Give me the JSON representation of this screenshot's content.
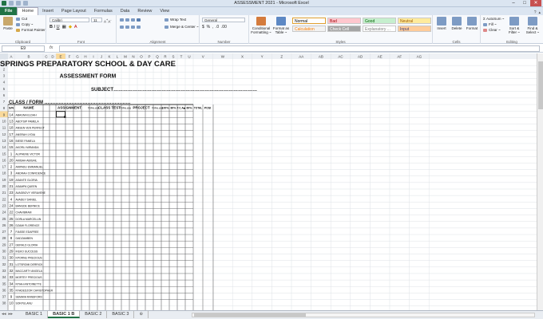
{
  "app": {
    "window_title": "ASSESSMENT 2021 - Microsoft Excel",
    "tabs": [
      "File",
      "Home",
      "Insert",
      "Page Layout",
      "Formulas",
      "Data",
      "Review",
      "View"
    ],
    "active_tab": "Home"
  },
  "ribbon": {
    "clipboard": {
      "paste": "Paste",
      "cut": "Cut",
      "copy": "Copy ~",
      "format_painter": "Format Painter",
      "label": "Clipboard"
    },
    "font": {
      "name": "Calibri",
      "size": "11",
      "label": "Font"
    },
    "alignment": {
      "wrap": "Wrap Text",
      "merge": "Merge & Center ~",
      "label": "Alignment"
    },
    "number": {
      "format": "General",
      "label": "Number"
    },
    "styles": {
      "conditional": "Conditional Formatting ~",
      "format_table": "Format as Table ~",
      "cells": [
        {
          "name": "Normal",
          "bg": "#ffffff",
          "fg": "#000000"
        },
        {
          "name": "Bad",
          "bg": "#ffc7ce",
          "fg": "#9c0006"
        },
        {
          "name": "Good",
          "bg": "#c6efce",
          "fg": "#006100"
        },
        {
          "name": "Neutral",
          "bg": "#ffeb9c",
          "fg": "#9c5700"
        },
        {
          "name": "Calculation",
          "bg": "#f2f2f2",
          "fg": "#fa7d00"
        },
        {
          "name": "Check Cell",
          "bg": "#a5a5a5",
          "fg": "#ffffff"
        },
        {
          "name": "Explanatory ...",
          "bg": "#ffffff",
          "fg": "#7f7f7f"
        },
        {
          "name": "Input",
          "bg": "#ffcc99",
          "fg": "#3f3f76"
        }
      ],
      "label": "Styles"
    },
    "cells_group": {
      "insert": "Insert",
      "delete": "Delete",
      "format": "Format",
      "label": "Cells"
    },
    "editing": {
      "autosum": "AutoSum ~",
      "fill": "Fill ~",
      "clear": "Clear ~",
      "sort": "Sort & Filter ~",
      "find": "Find & Select ~",
      "label": "Editing"
    }
  },
  "formula_bar": {
    "name_box": "E9",
    "fx": "fx",
    "value": ""
  },
  "sheet": {
    "columns": [
      "A",
      "B",
      "C",
      "D",
      "E",
      "F",
      "G",
      "H",
      "I",
      "J",
      "K",
      "L",
      "M",
      "N",
      "O",
      "P",
      "Q",
      "R",
      "S",
      "T",
      "U",
      "V",
      "W",
      "X",
      "Y",
      "Z",
      "AA",
      "AB",
      "AC",
      "AD",
      "AE",
      "AF",
      "AG"
    ],
    "row_numbers": [
      "1",
      "2",
      "3",
      "4",
      "5",
      "6",
      "7",
      "8",
      "9",
      "10",
      "11",
      "12",
      "13",
      "14",
      "15",
      "16",
      "17",
      "18",
      "19",
      "20",
      "21",
      "22",
      "23",
      "24",
      "25",
      "26",
      "27",
      "28",
      "29",
      "30",
      "31",
      "32",
      "33",
      "34",
      "35",
      "36",
      "37",
      "38"
    ],
    "title": "SPRINGS PREPARATORY SCHOOL & DAY CARE",
    "subtitle": "ASSESSMENT FORM",
    "subject_label": "SUBJECT………………………………………………………………………………",
    "class_label": "CLASS / FORM ………………………………………………",
    "headers": {
      "sn": "S/N",
      "name": "NAME",
      "assignment": "ASSIGNMENT",
      "total_assign": "TOTAL (10)",
      "class_test": "CLASS TEST",
      "total_test": "TOTAL (10)",
      "project": "PROJECT",
      "total_project": "TOTAL (10)",
      "p100": "100%",
      "p80": "80%",
      "tca": "T.C.A◆",
      "p60": "60%",
      "total": "TOTAL",
      "posi": "POSI"
    },
    "students": [
      {
        "row": "9",
        "sn": "14",
        "name": "ABAGNA ELDAH"
      },
      {
        "row": "10",
        "sn": "13",
        "name": "ABOTSIP PAMELA"
      },
      {
        "row": "11",
        "sn": "18",
        "name": "ANSEN VEN PERFECT"
      },
      {
        "row": "12",
        "sn": "17",
        "name": "ANSRAH LYDIA"
      },
      {
        "row": "13",
        "sn": "16",
        "name": "BIESE PAMELA"
      },
      {
        "row": "14",
        "sn": "15",
        "name": "AKORLI MIRANDA"
      },
      {
        "row": "15",
        "sn": "1",
        "name": "ALIPHENE VICTOR"
      },
      {
        "row": "16",
        "sn": "20",
        "name": "AMISAH ABIGAIL"
      },
      {
        "row": "17",
        "sn": "2",
        "name": "AMPADU EMMANUEL"
      },
      {
        "row": "18",
        "sn": "3",
        "name": "ANDRAH CONFIDENCE"
      },
      {
        "row": "19",
        "sn": "19",
        "name": "ASANTE GLORIA"
      },
      {
        "row": "20",
        "sn": "21",
        "name": "ASAMPA QUEEN"
      },
      {
        "row": "21",
        "sn": "23",
        "name": "AVAGBOVY VERAVENE"
      },
      {
        "row": "22",
        "sn": "4",
        "name": "AVADEY DANIEL"
      },
      {
        "row": "23",
        "sn": "24",
        "name": "BANGDE BERNICE"
      },
      {
        "row": "24",
        "sn": "22",
        "name": "CHAVIBRAM"
      },
      {
        "row": "25",
        "sn": "25",
        "name": "DORLA MARCELLIN"
      },
      {
        "row": "26",
        "sn": "26",
        "name": "DZAMI FLORENCE"
      },
      {
        "row": "27",
        "sn": "7",
        "name": "FIASSE EDAFREE"
      },
      {
        "row": "28",
        "sn": "8",
        "name": "GADZAMBEN"
      },
      {
        "row": "29",
        "sn": "27",
        "name": "GERALD GLORIA"
      },
      {
        "row": "30",
        "sn": "29",
        "name": "IKEKO SUCCESS"
      },
      {
        "row": "31",
        "sn": "30",
        "name": "KPORNU PRECIOUS"
      },
      {
        "row": "32",
        "sn": "31",
        "name": "LOTSROMI DERRICK"
      },
      {
        "row": "33",
        "sn": "32",
        "name": "MACCARTY ANGELA"
      },
      {
        "row": "34",
        "sn": "33",
        "name": "MORTEY PRECIOUS"
      },
      {
        "row": "35",
        "sn": "34",
        "name": "NTIAH ANTOINETTE"
      },
      {
        "row": "36",
        "sn": "35",
        "name": "NYADEDZOR CHRISTOPHER"
      },
      {
        "row": "37",
        "sn": "9",
        "name": "SEMAVA RANSFORD"
      },
      {
        "row": "38",
        "sn": "10",
        "name": "SOKPULANU"
      }
    ]
  },
  "sheet_tabs": [
    "BASIC 1",
    "BASIC 1 B",
    "BASIC 2",
    "BASIC 3"
  ],
  "active_sheet": "BASIC 1 B"
}
